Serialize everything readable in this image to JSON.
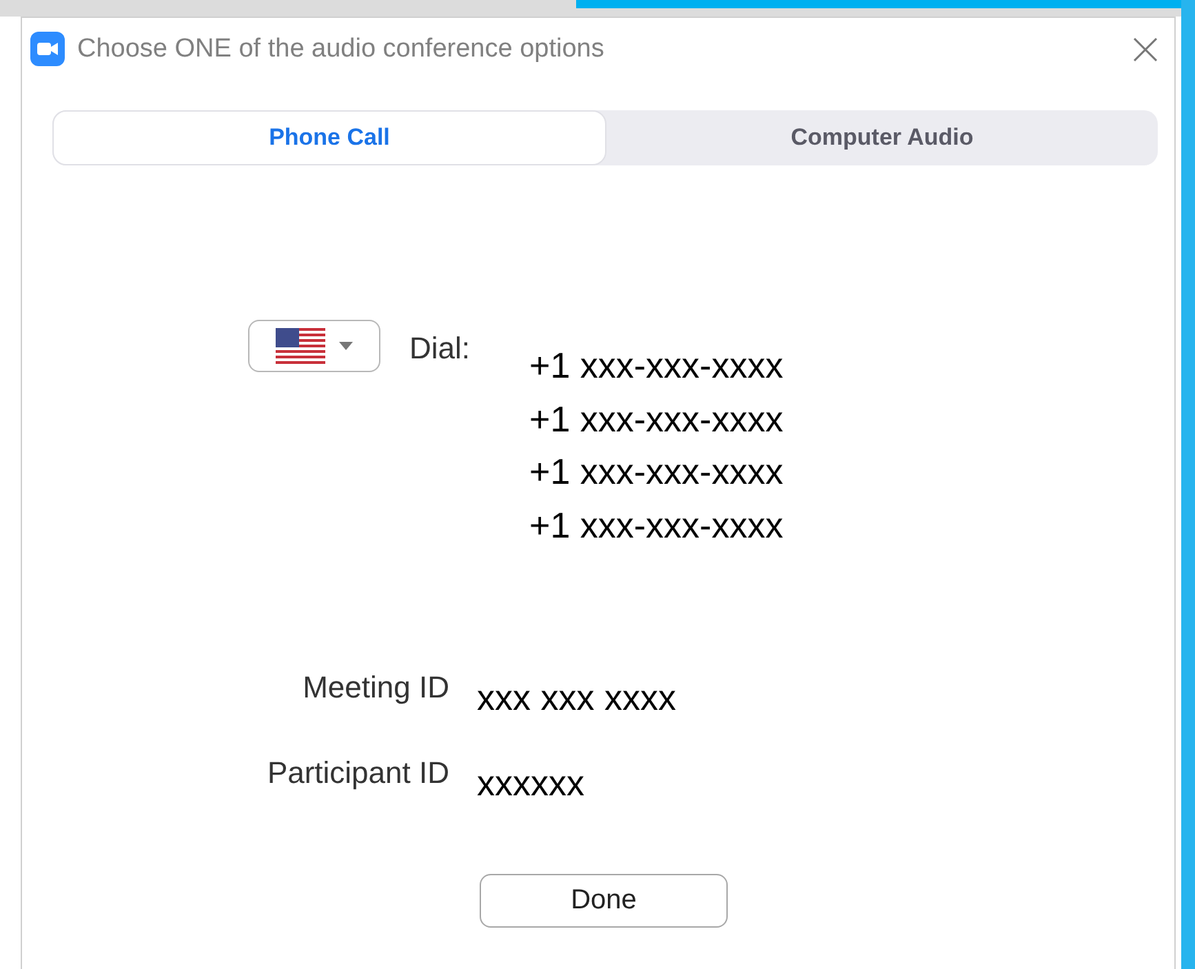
{
  "window": {
    "title": "Choose ONE of the audio conference options"
  },
  "tabs": [
    {
      "label": "Phone Call",
      "selected": true
    },
    {
      "label": "Computer Audio",
      "selected": false
    }
  ],
  "dial": {
    "label": "Dial:",
    "numbers": [
      "+1 xxx-xxx-xxxx",
      "+1 xxx-xxx-xxxx",
      "+1 xxx-xxx-xxxx",
      "+1 xxx-xxx-xxxx"
    ]
  },
  "ids": [
    {
      "label": "Meeting ID",
      "value": "xxx xxx xxxx"
    },
    {
      "label": "Participant ID",
      "value": "xxxxxx"
    }
  ],
  "buttons": [
    "Done"
  ]
}
